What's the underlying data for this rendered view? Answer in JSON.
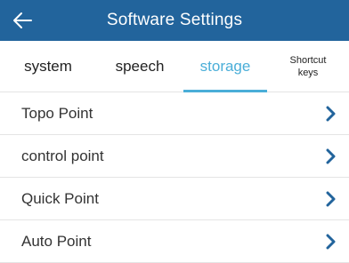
{
  "header": {
    "title": "Software Settings",
    "back_icon": "arrow-left-icon",
    "background_color": "#22649c"
  },
  "tabs": [
    {
      "label": "system",
      "active": false
    },
    {
      "label": "speech",
      "active": false
    },
    {
      "label": "storage",
      "active": true
    },
    {
      "label_line1": "Shortcut",
      "label_line2": "keys",
      "active": false
    }
  ],
  "accent_color": "#4aaed8",
  "settings_list": [
    {
      "label": "Topo Point",
      "icon": "chevron-right-icon"
    },
    {
      "label": "control point",
      "icon": "chevron-right-icon"
    },
    {
      "label": "Quick Point",
      "icon": "chevron-right-icon"
    },
    {
      "label": "Auto Point",
      "icon": "chevron-right-icon"
    }
  ]
}
